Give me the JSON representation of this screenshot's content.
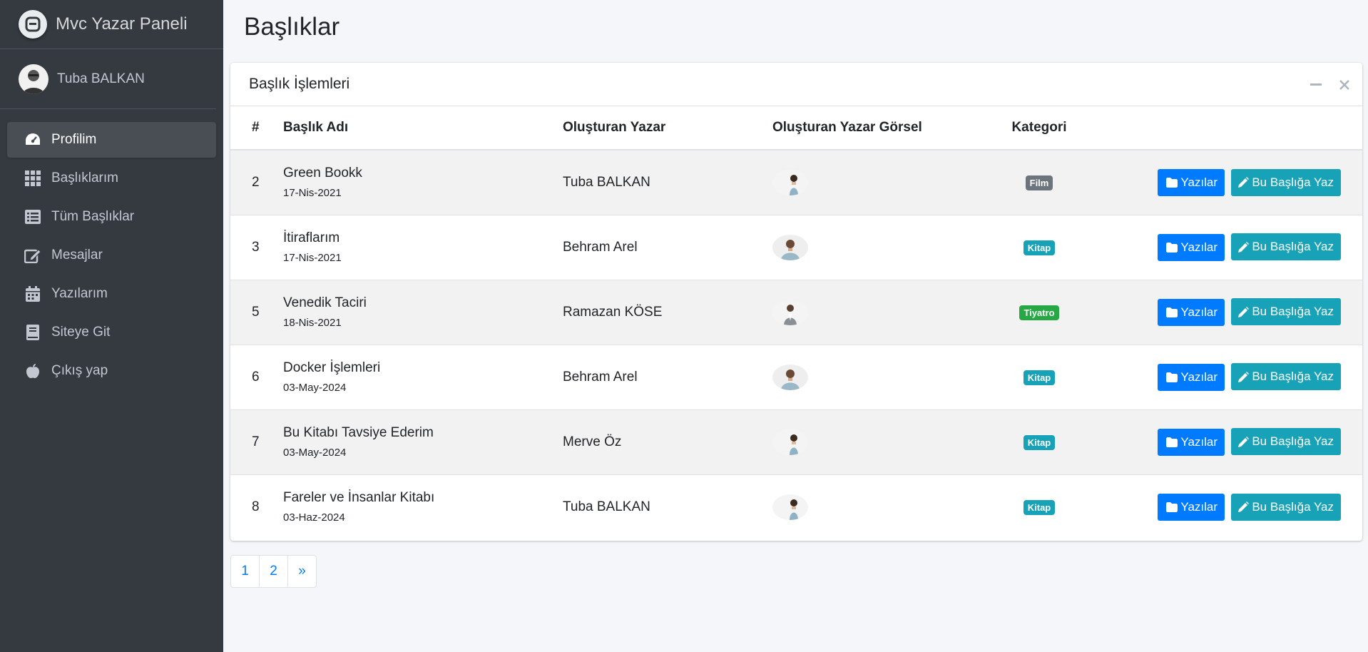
{
  "brand": {
    "title": "Mvc Yazar Paneli"
  },
  "user": {
    "name": "Tuba BALKAN"
  },
  "sidebar": {
    "items": [
      {
        "label": "Profilim",
        "icon": "tachometer-icon",
        "active": true
      },
      {
        "label": "Başlıklarım",
        "icon": "grid-icon"
      },
      {
        "label": "Tüm Başlıklar",
        "icon": "list-icon"
      },
      {
        "label": "Mesajlar",
        "icon": "edit-icon"
      },
      {
        "label": "Yazılarım",
        "icon": "calendar-icon"
      },
      {
        "label": "Siteye Git",
        "icon": "book-icon"
      },
      {
        "label": "Çıkış yap",
        "icon": "apple-icon"
      }
    ]
  },
  "page": {
    "title": "Başlıklar"
  },
  "card": {
    "title": "Başlık İşlemleri"
  },
  "table": {
    "headers": [
      "#",
      "Başlık Adı",
      "Oluşturan Yazar",
      "Oluşturan Yazar Görsel",
      "Kategori",
      ""
    ],
    "rows": [
      {
        "id": "2",
        "title": "Green Bookk",
        "date": "17-Nis-2021",
        "author": "Tuba BALKAN",
        "category": "Film",
        "category_color": "#6c757d",
        "avatar": "woman"
      },
      {
        "id": "3",
        "title": "İtiraflarım",
        "date": "17-Nis-2021",
        "author": "Behram Arel",
        "category": "Kitap",
        "category_color": "#17a2b8",
        "avatar": "man"
      },
      {
        "id": "5",
        "title": "Venedik Taciri",
        "date": "18-Nis-2021",
        "author": "Ramazan KÖSE",
        "category": "Tiyatro",
        "category_color": "#28a745",
        "avatar": "man-suit"
      },
      {
        "id": "6",
        "title": "Docker İşlemleri",
        "date": "03-May-2024",
        "author": "Behram Arel",
        "category": "Kitap",
        "category_color": "#17a2b8",
        "avatar": "man"
      },
      {
        "id": "7",
        "title": "Bu Kitabı Tavsiye Ederim",
        "date": "03-May-2024",
        "author": "Merve Öz",
        "category": "Kitap",
        "category_color": "#17a2b8",
        "avatar": "woman"
      },
      {
        "id": "8",
        "title": "Fareler ve İnsanlar Kitabı",
        "date": "03-Haz-2024",
        "author": "Tuba BALKAN",
        "category": "Kitap",
        "category_color": "#17a2b8",
        "avatar": "woman"
      }
    ],
    "actions": {
      "posts_label": "Yazılar",
      "write_label": "Bu Başlığa Yaz"
    }
  },
  "pagination": {
    "pages": [
      "1",
      "2",
      "»"
    ]
  },
  "colors": {
    "primary": "#007bff",
    "info": "#17a2b8",
    "sidebar": "#343a40"
  }
}
